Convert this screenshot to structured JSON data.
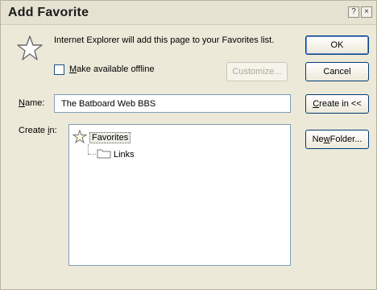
{
  "window": {
    "title": "Add Favorite",
    "help_glyph": "?",
    "close_glyph": "×"
  },
  "message": "Internet Explorer will add this page to your Favorites list.",
  "offline": {
    "label_accel": "M",
    "label_rest": "ake available offline",
    "checked": false
  },
  "buttons": {
    "ok": "OK",
    "cancel": "Cancel",
    "customize": "Customize...",
    "create_in_accel": "C",
    "create_in_rest": "reate in <<",
    "new_folder_pre": "Ne",
    "new_folder_accel": "w",
    "new_folder_post": " Folder..."
  },
  "name_field": {
    "label_accel": "N",
    "label_rest": "ame:",
    "value": "The Batboard Web BBS"
  },
  "create_in": {
    "label_pre": "Create ",
    "label_accel": "i",
    "label_post": "n:"
  },
  "tree": {
    "root": {
      "label": "Favorites",
      "icon": "star-icon"
    },
    "children": [
      {
        "label": "Links",
        "icon": "folder-icon"
      }
    ]
  },
  "colors": {
    "dialog_bg": "#ece9d8",
    "field_border": "#7f9db9",
    "button_border": "#003c74"
  }
}
